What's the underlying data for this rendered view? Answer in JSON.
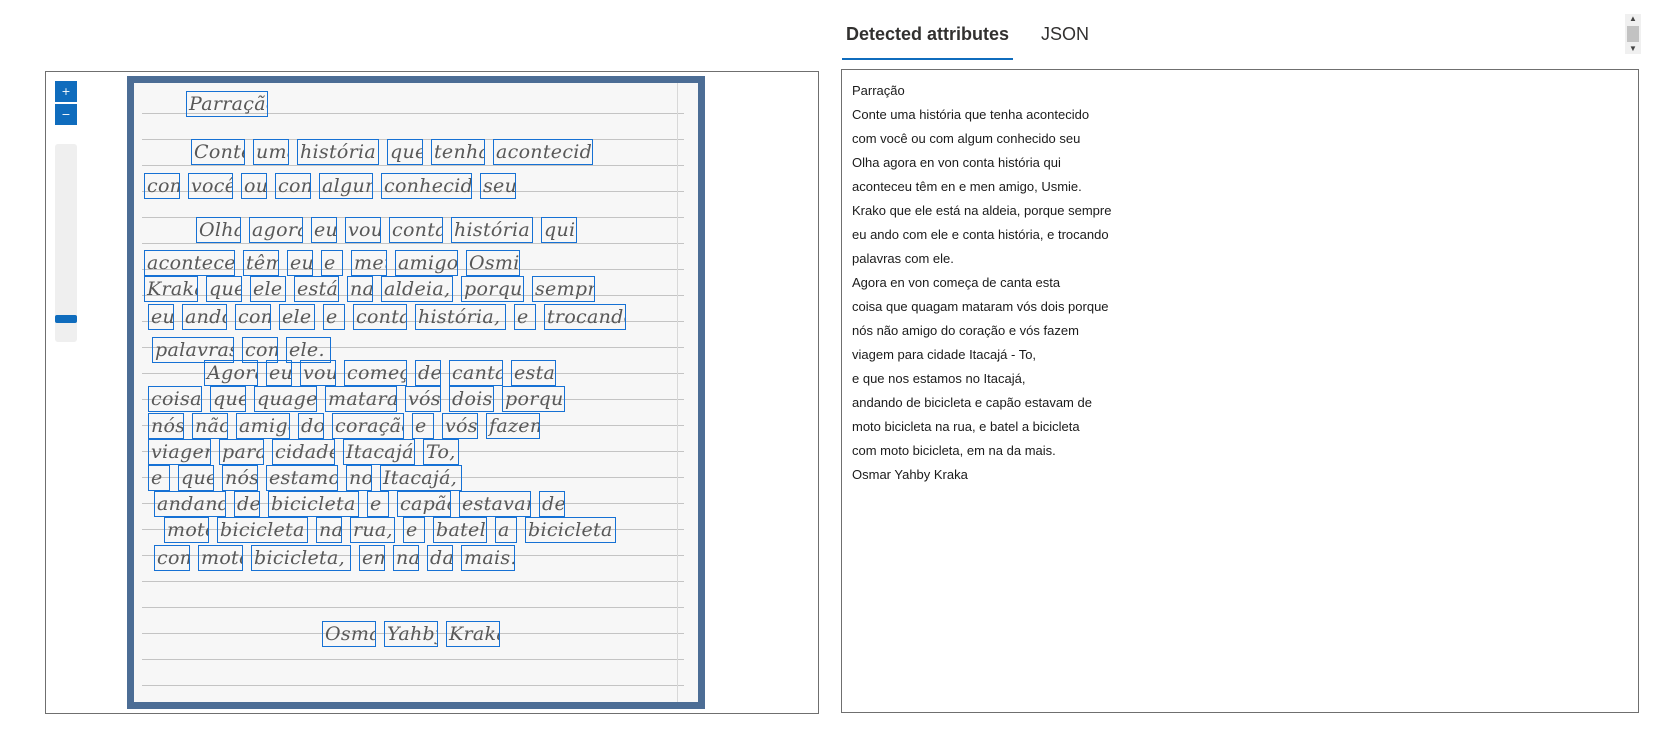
{
  "tabs": [
    {
      "label": "Detected attributes",
      "active": true
    },
    {
      "label": "JSON",
      "active": false
    }
  ],
  "viewer": {
    "zoom_in_icon": "zoom-in-icon",
    "zoom_out_icon": "zoom-out-icon",
    "zoom_level": 0.9
  },
  "colors": {
    "accent": "#0f6cbd",
    "word_box": "#1671d4",
    "frame": "#4c6d95"
  },
  "ocr_lines": [
    "Parração",
    "Conte uma história que tenha acontecido",
    "com você ou com algum conhecido seu",
    "Olha agora en von conta história qui",
    "aconteceu têm en e men amigo, Usmie.",
    "Krako que ele está na aldeia, porque sempre",
    "eu ando com ele e conta história, e trocando",
    "palavras com ele.",
    "Agora en von começa de canta esta",
    "coisa que quagam mataram vós dois porque",
    "nós não amigo do coração e vós fazem",
    "viagem para cidade Itacajá - To,",
    "e que nos estamos no Itacajá,",
    "andando de bicicleta e capão estavam de",
    "moto bicicleta na rua, e batel a bicicleta",
    "com moto bicicleta, em na da mais.",
    "Osmar Yahby Kraka"
  ],
  "handwriting": [
    [
      "Parração"
    ],
    [
      "Conte",
      "uma",
      "história",
      "que",
      "tenha",
      "acontecido"
    ],
    [
      "com",
      "você",
      "ou",
      "com",
      "algum",
      "conhecido",
      "seu"
    ],
    [
      "Olha",
      "agora",
      "eu",
      "vou",
      "conta",
      "história",
      "qui"
    ],
    [
      "aconteceu",
      "têm",
      "eu",
      "e",
      "meu",
      "amigo,",
      "Osmir"
    ],
    [
      "Krakã",
      "que",
      "ele",
      "está",
      "na",
      "aldeia,",
      "porque",
      "sempre"
    ],
    [
      "eu",
      "ando",
      "com",
      "ele",
      "e",
      "conta",
      "história,",
      "e",
      "trocando"
    ],
    [
      "palavras",
      "com",
      "ele."
    ],
    [
      "Agora",
      "eu",
      "vou",
      "começa",
      "de",
      "canta",
      "esta"
    ],
    [
      "coisa",
      "que",
      "quagem",
      "mataram",
      "vós",
      "dois",
      "porque"
    ],
    [
      "nós",
      "não",
      "amigo",
      "do",
      "coração",
      "e",
      "vós",
      "fazem"
    ],
    [
      "viagem",
      "para",
      "cidade",
      "Itacajá",
      "To,"
    ],
    [
      "e",
      "que",
      "nós",
      "estamos",
      "no",
      "Itacajá,"
    ],
    [
      "andando",
      "de",
      "bicicleta",
      "e",
      "capão",
      "estavam",
      "de"
    ],
    [
      "moto",
      "bicicleta",
      "na",
      "rua,",
      "e",
      "batel",
      "a",
      "bicicleta"
    ],
    [
      "com",
      "moto",
      "bicicleta,",
      "em",
      "na",
      "da",
      "mais."
    ],
    [
      "Osmar",
      "Yahby",
      "Krakã"
    ]
  ]
}
